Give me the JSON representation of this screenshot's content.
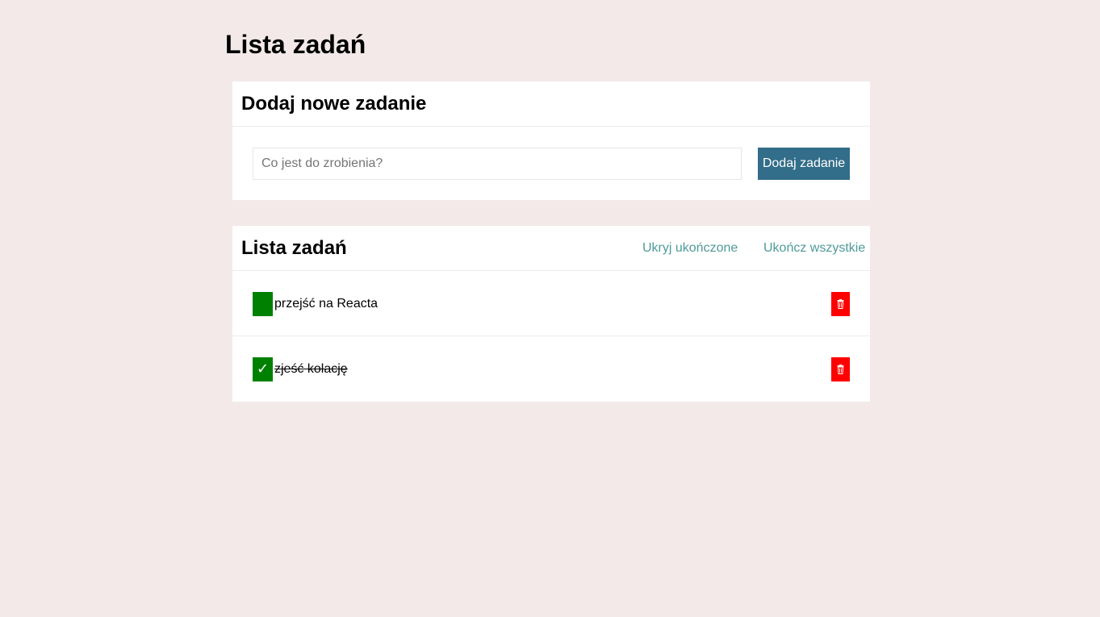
{
  "page": {
    "title": "Lista zadań"
  },
  "add_section": {
    "title": "Dodaj nowe zadanie",
    "input_placeholder": "Co jest do zrobienia?",
    "input_value": "",
    "button_label": "Dodaj zadanie"
  },
  "list_section": {
    "title": "Lista zadań",
    "hide_completed_label": "Ukryj ukończone",
    "complete_all_label": "Ukończ wszystkie",
    "tasks": [
      {
        "text": "przejść na Reacta",
        "done": false,
        "check_mark": ""
      },
      {
        "text": "zjeść kolację",
        "done": true,
        "check_mark": "✓"
      }
    ]
  },
  "colors": {
    "background": "#f3e9e9",
    "accent_button": "#326d89",
    "link": "#4f9a9a",
    "checkbox": "#008000",
    "delete": "#ff0000"
  },
  "icons": {
    "checkbox": "check-icon",
    "delete": "trash-icon"
  }
}
